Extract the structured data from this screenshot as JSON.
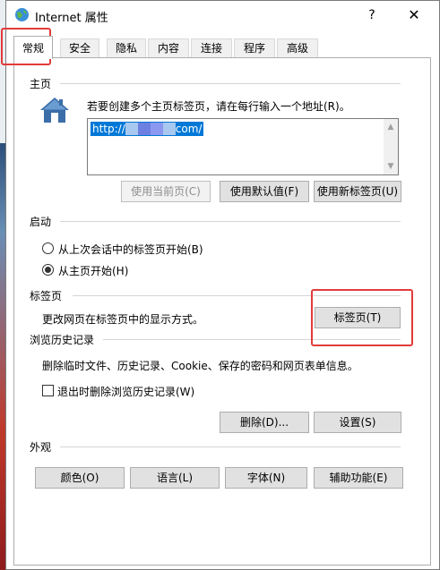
{
  "window": {
    "title": "Internet 属性",
    "help_label": "?",
    "close_label": "✕"
  },
  "tabs": [
    {
      "label": "常规",
      "active": true
    },
    {
      "label": "安全"
    },
    {
      "label": "隐私"
    },
    {
      "label": "内容"
    },
    {
      "label": "连接"
    },
    {
      "label": "程序"
    },
    {
      "label": "高级"
    }
  ],
  "home": {
    "group_label": "主页",
    "description": "若要创建多个主页标签页，请在每行输入一个地址(R)。",
    "url_prefix": "http://",
    "url_suffix": "com/",
    "btn_use_current": "使用当前页(C)",
    "btn_use_default": "使用默认值(F)",
    "btn_use_new_tab": "使用新标签页(U)"
  },
  "startup": {
    "group_label": "启动",
    "option_last_session": "从上次会话中的标签页开始(B)",
    "option_home_page": "从主页开始(H)"
  },
  "tabs_section": {
    "group_label": "标签页",
    "description": "更改网页在标签页中的显示方式。",
    "btn_tabs": "标签页(T)"
  },
  "history": {
    "group_label": "浏览历史记录",
    "description": "删除临时文件、历史记录、Cookie、保存的密码和网页表单信息。",
    "checkbox_delete_on_exit": "退出时删除浏览历史记录(W)",
    "btn_delete": "删除(D)...",
    "btn_settings": "设置(S)"
  },
  "appearance": {
    "group_label": "外观",
    "btn_colors": "颜色(O)",
    "btn_languages": "语言(L)",
    "btn_fonts": "字体(N)",
    "btn_accessibility": "辅助功能(E)"
  },
  "colors": {
    "accent": "#0078d7",
    "highlight_box": "#e23b3b",
    "redact_1": "#a8c8ef",
    "redact_2": "#6d7fe0",
    "redact_3": "#8c97f0"
  }
}
